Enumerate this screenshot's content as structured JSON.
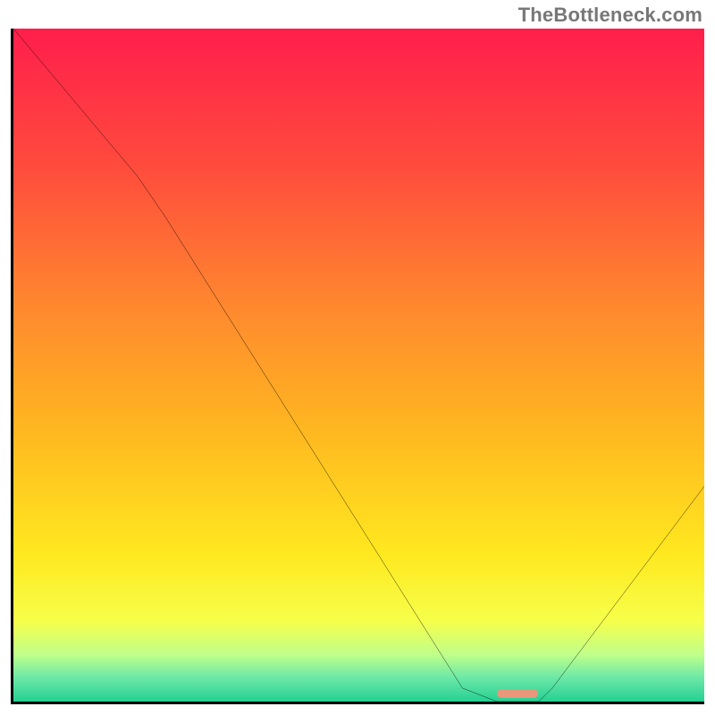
{
  "watermark": "TheBottleneck.com",
  "chart_data": {
    "type": "line",
    "title": "",
    "xlabel": "",
    "ylabel": "",
    "xlim": [
      0,
      100
    ],
    "ylim": [
      0,
      100
    ],
    "grid": false,
    "gradient_stops": [
      {
        "offset": 0,
        "color": "#FF1E4C"
      },
      {
        "offset": 0.2,
        "color": "#FF4A3D"
      },
      {
        "offset": 0.42,
        "color": "#FF8A2E"
      },
      {
        "offset": 0.6,
        "color": "#FFB820"
      },
      {
        "offset": 0.78,
        "color": "#FFE81F"
      },
      {
        "offset": 0.88,
        "color": "#F6FF4A"
      },
      {
        "offset": 0.93,
        "color": "#C0FF8A"
      },
      {
        "offset": 0.965,
        "color": "#6BE8A8"
      },
      {
        "offset": 1.0,
        "color": "#25D093"
      }
    ],
    "series": [
      {
        "name": "bottleneck-curve",
        "x": [
          0,
          18,
          22,
          65,
          70,
          76,
          78,
          100
        ],
        "values": [
          100,
          78,
          72,
          2,
          0,
          0,
          2,
          32
        ]
      }
    ],
    "marker": {
      "x": 73,
      "y": 0.5,
      "width_pct": 6,
      "height_pct": 1.4,
      "color": "#E9967A"
    }
  }
}
